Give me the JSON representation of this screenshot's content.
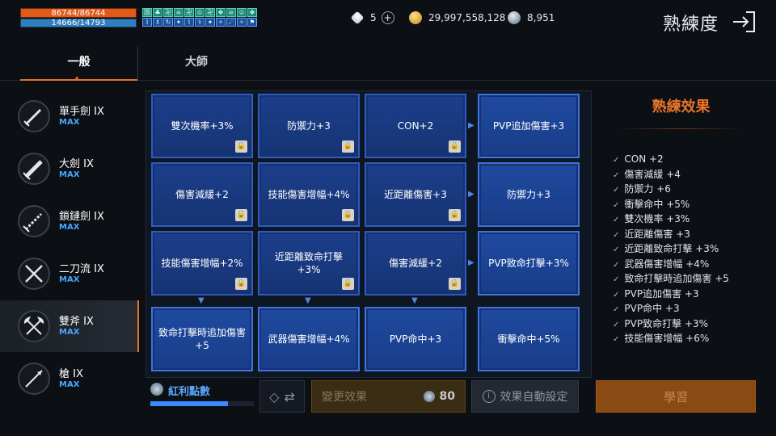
{
  "status": {
    "hp": "86744/86744",
    "mp": "14666/14793"
  },
  "buffs": [
    "国",
    "♣",
    "卍",
    "☠",
    "卍",
    "♔",
    "卍",
    "❖",
    "☠",
    "♔",
    "❖",
    "Ⅰ",
    "♗",
    "↻",
    "✦",
    "⌇",
    "⚕",
    "✦",
    "✧",
    "☄",
    "✧",
    "⚑"
  ],
  "currency": {
    "diamonds": "5",
    "gold": "29,997,558,128",
    "silver": "8,951"
  },
  "header": {
    "title": "熟練度"
  },
  "tabs": [
    "一般",
    "大師"
  ],
  "weapons": [
    {
      "name": "單手劍 IX",
      "level": "MAX",
      "icon": "one-handed-sword-icon"
    },
    {
      "name": "大劍 IX",
      "level": "MAX",
      "icon": "greatsword-icon"
    },
    {
      "name": "鎖鏈劍 IX",
      "level": "MAX",
      "icon": "chain-sword-icon"
    },
    {
      "name": "二刀流 IX",
      "level": "MAX",
      "icon": "dual-swords-icon"
    },
    {
      "name": "雙斧 IX",
      "level": "MAX",
      "icon": "dual-axes-icon"
    },
    {
      "name": "槍 IX",
      "level": "MAX",
      "icon": "spear-icon"
    }
  ],
  "cards": [
    {
      "label": "雙次機率+3%",
      "locked": true
    },
    {
      "label": "防禦力+3",
      "locked": true
    },
    {
      "label": "CON+2",
      "locked": true
    },
    {
      "label": "PVP追加傷害+3",
      "locked": false
    },
    {
      "label": "傷害減緩+2",
      "locked": true
    },
    {
      "label": "技能傷害增幅+4%",
      "locked": true
    },
    {
      "label": "近距離傷害+3",
      "locked": true
    },
    {
      "label": "防禦力+3",
      "locked": false
    },
    {
      "label": "技能傷害增幅+2%",
      "locked": true
    },
    {
      "label": "近距離致命打擊+3%",
      "locked": true
    },
    {
      "label": "傷害減緩+2",
      "locked": true
    },
    {
      "label": "PVP致命打擊+3%",
      "locked": false
    },
    {
      "label": "致命打擊時追加傷害+5",
      "locked": false
    },
    {
      "label": "武器傷害增幅+4%",
      "locked": false
    },
    {
      "label": "PVP命中+3",
      "locked": false
    },
    {
      "label": "衝擊命中+5%",
      "locked": false
    }
  ],
  "effects": {
    "title": "熟練效果",
    "items": [
      "CON +2",
      "傷害減緩 +4",
      "防禦力 +6",
      "衝擊命中 +5%",
      "雙次機率 +3%",
      "近距離傷害 +3",
      "近距離致命打擊 +3%",
      "武器傷害增幅 +4%",
      "致命打擊時追加傷害 +5",
      "PVP追加傷害 +3",
      "PVP命中 +3",
      "PVP致命打擊 +3%",
      "技能傷害增幅 +6%"
    ]
  },
  "bonus": {
    "label": "紅利點數",
    "progress": 0.75
  },
  "buttons": {
    "change": "變更效果",
    "change_cost": "80",
    "auto": "效果自動設定",
    "learn": "學習"
  },
  "colors": {
    "accent": "#e0742a",
    "max": "#47a8ff",
    "card": "#1c3f8c"
  }
}
